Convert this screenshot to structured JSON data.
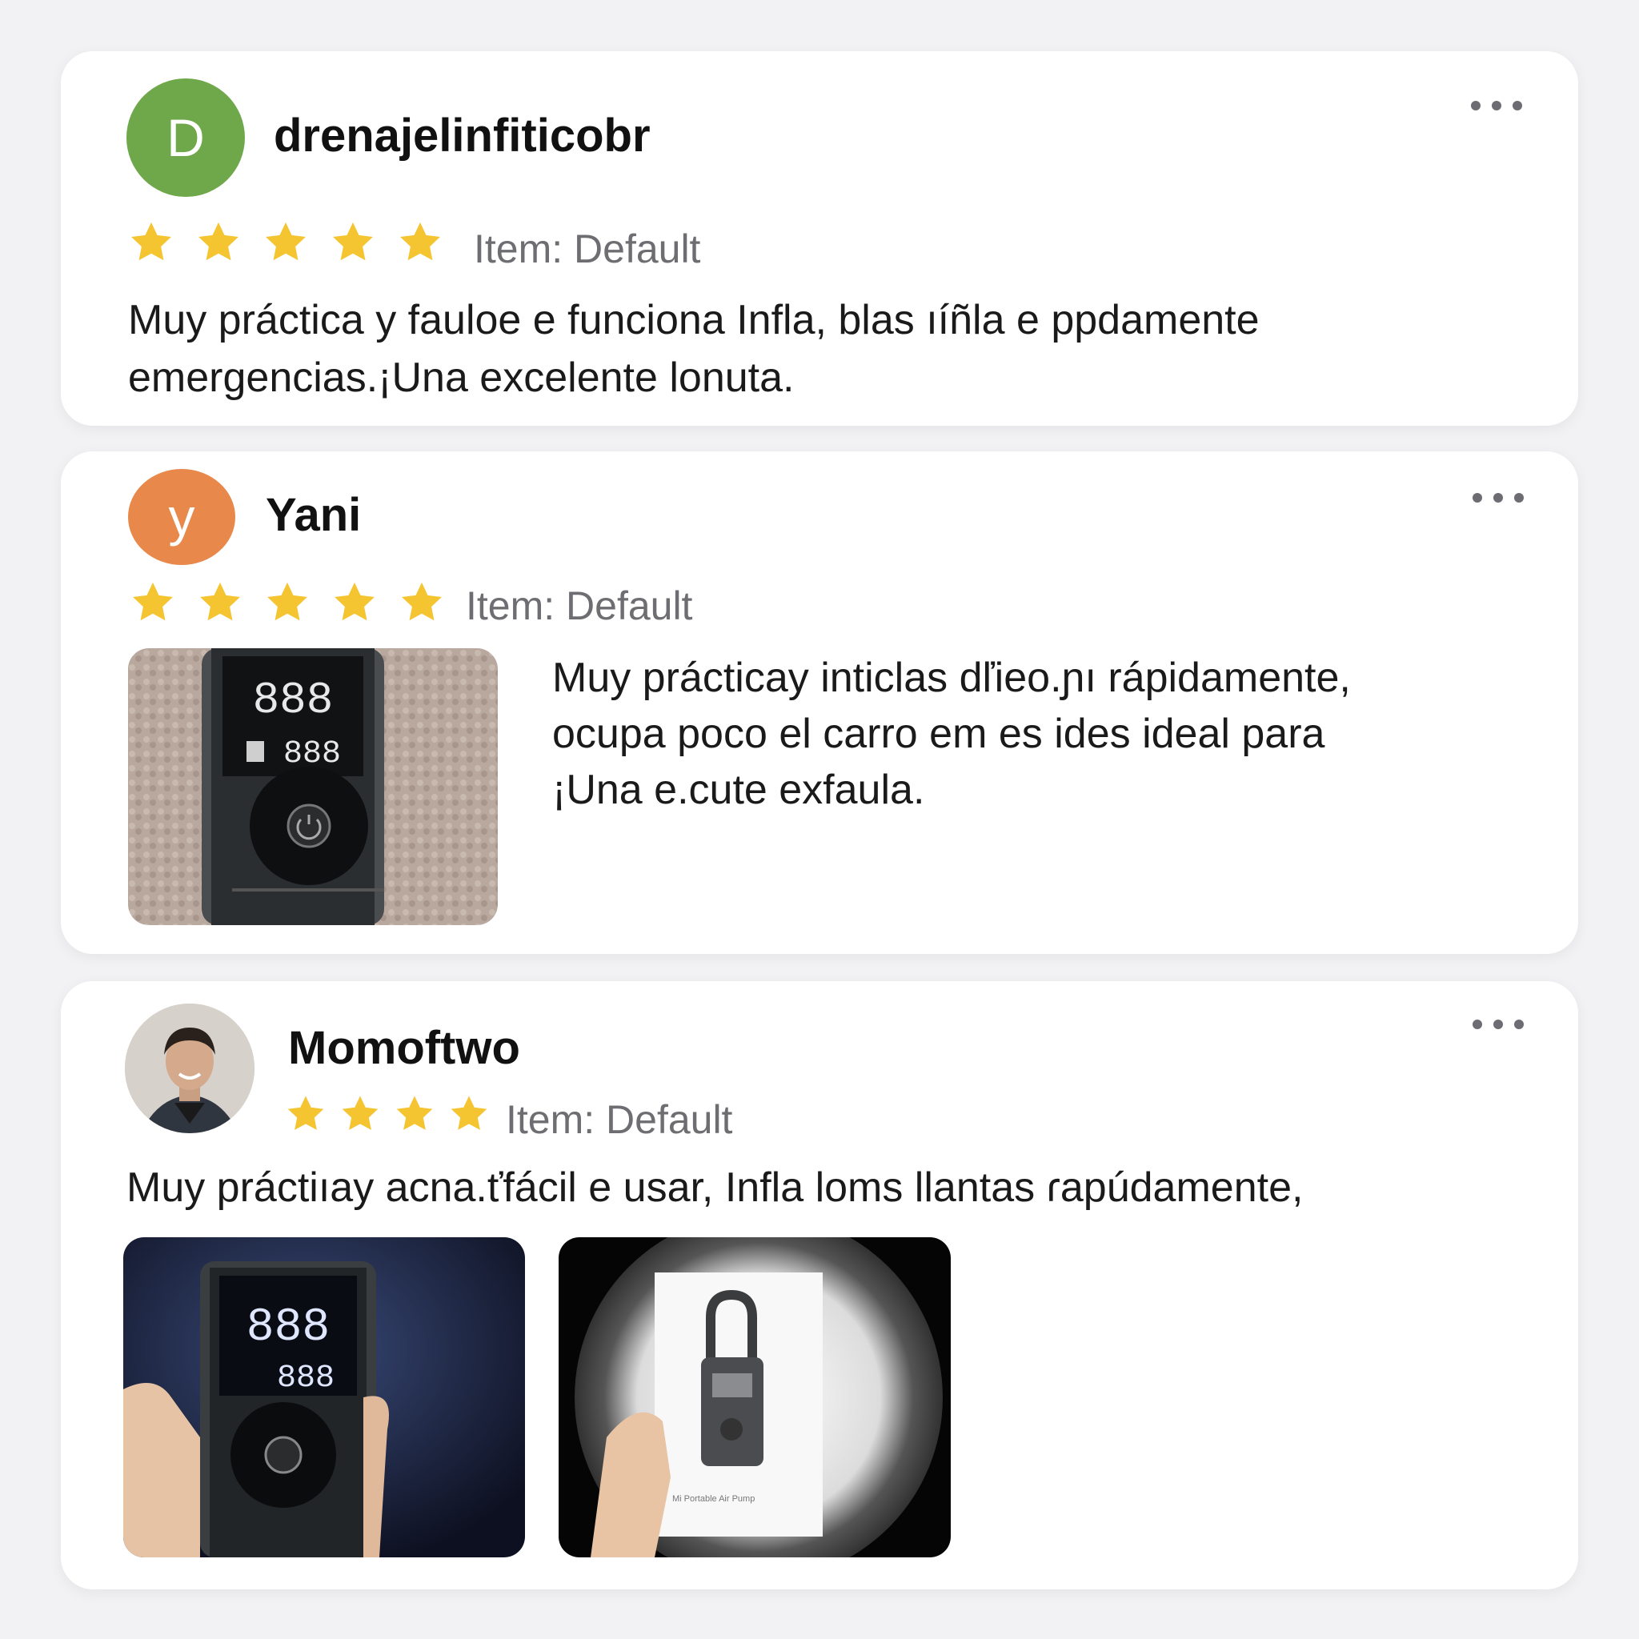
{
  "reviews": [
    {
      "avatar_letter": "D",
      "avatar_color": "#6ea84a",
      "username": "drenajelinfiticobr",
      "rating": 5,
      "item_label": "Item: Default",
      "text_lines": [
        "Muy práctica y fauloe e funciona Infla, blas ıíñla e ppdamente",
        "emergencias.¡Una excelente lonuta."
      ]
    },
    {
      "avatar_letter": "y",
      "avatar_color": "#e8884a",
      "username": "Yani",
      "rating": 5,
      "item_label": "Item: Default",
      "text_lines": [
        "Muy prácticay inticlas dľieo.ɲı rápidamente,",
        "ocupa poco el carro em es ides ideal para",
        "¡Una e.cute exfaula."
      ],
      "photo": {
        "display_main": "888",
        "display_sub": "888"
      }
    },
    {
      "avatar_type": "photo",
      "username": "Momoftwo",
      "rating": 4,
      "item_label": "Item: Default",
      "text_lines": [
        "Muy práctiıay acna.ťfácil e usar, Infla loms llantas ɾapúdamente,"
      ],
      "photos": [
        {
          "display_main": "888",
          "display_sub": "888"
        },
        {
          "box_text": "Mi Portable Air Pump"
        }
      ]
    }
  ],
  "colors": {
    "star": "#f5c431",
    "card_bg": "#ffffff",
    "page_bg": "#f2f2f4"
  }
}
